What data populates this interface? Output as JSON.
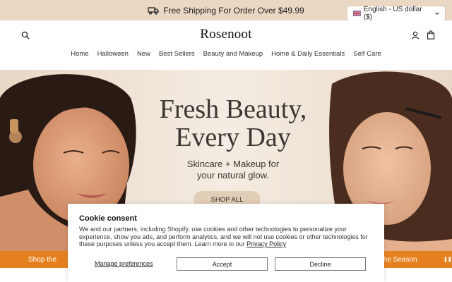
{
  "announcement": {
    "text": "Free Shipping For Order Over $49.99",
    "icon": "truck-icon"
  },
  "locale": {
    "label": "English - US dollar ($)"
  },
  "header": {
    "logo": "Rosenoot",
    "nav": [
      "Home",
      "Halloween",
      "New",
      "Best Sellers",
      "Beauty and Makeup",
      "Home & Daily Essentials",
      "Self Care"
    ]
  },
  "hero": {
    "title_line1": "Fresh Beauty,",
    "title_line2": "Every Day",
    "subtitle_line1": "Skincare + Makeup for",
    "subtitle_line2": "your natural glow.",
    "cta": "SHOP ALL"
  },
  "promo": {
    "left_text": "Shop the",
    "right_text": "the Season",
    "pause_icon": "pause-icon"
  },
  "cookie": {
    "title": "Cookie consent",
    "body": "We and our partners, including Shopify, use cookies and other technologies to personalize your experience, show you ads, and perform analytics, and we will not use cookies or other technologies for these purposes unless you accept them. Learn more in our",
    "link": "Privacy Policy",
    "manage": "Manage preferences",
    "accept": "Accept",
    "decline": "Decline"
  },
  "colors": {
    "announcement_bg": "#ead7c4",
    "promo_bg": "#e6801f",
    "hero_bg": "#f1e8dc",
    "cta_bg": "#e2cdb6"
  }
}
